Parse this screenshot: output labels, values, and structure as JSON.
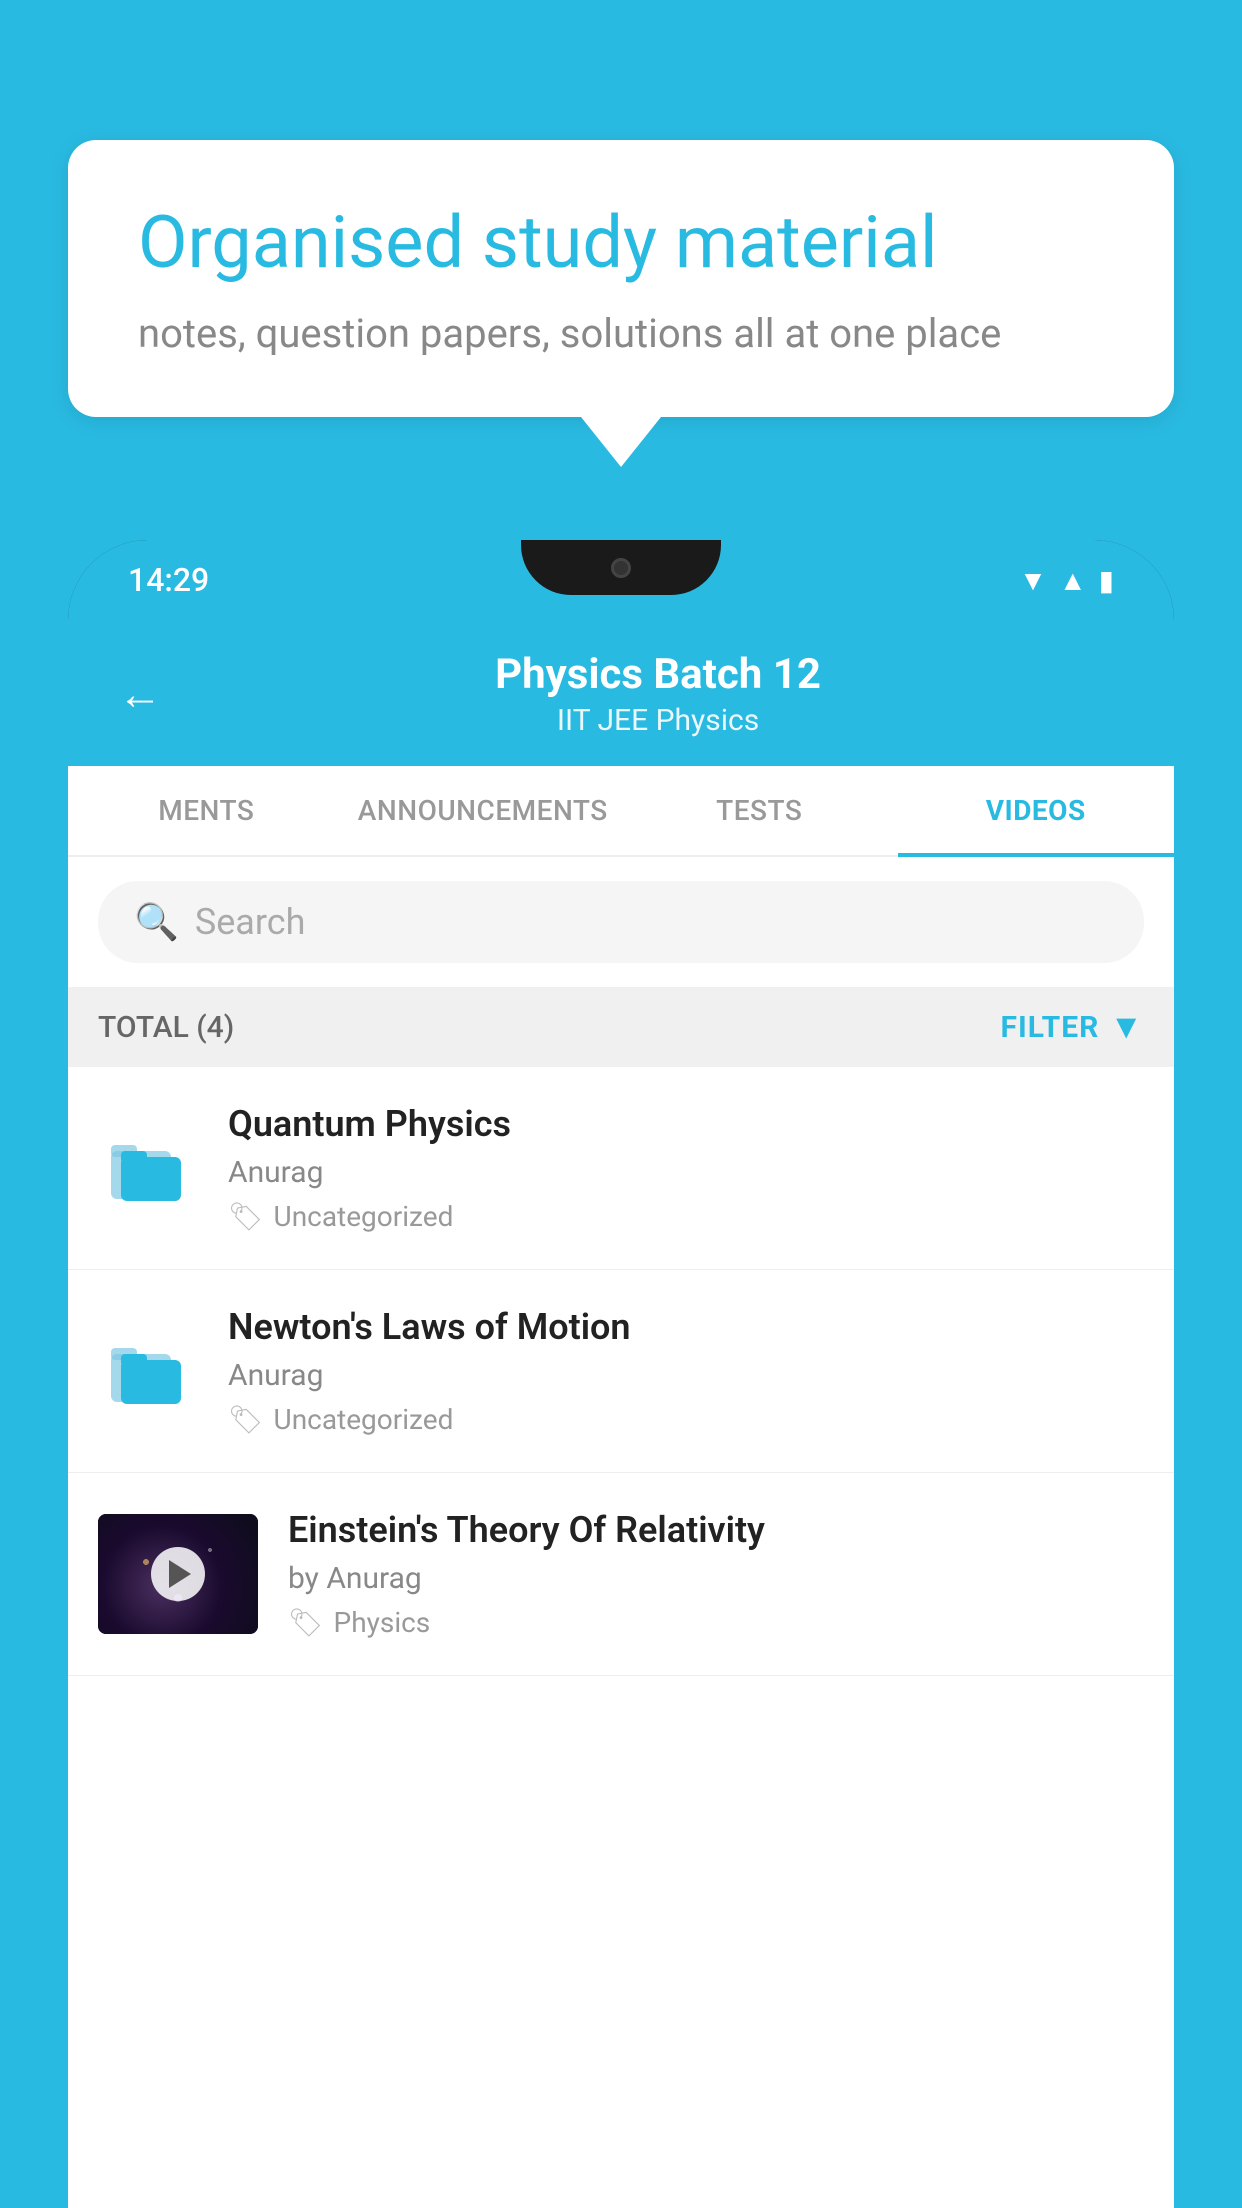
{
  "background": {
    "color": "#29BAE2"
  },
  "speech_bubble": {
    "title": "Organised study material",
    "subtitle": "notes, question papers, solutions all at one place"
  },
  "phone": {
    "status_bar": {
      "time": "14:29"
    },
    "header": {
      "back_label": "←",
      "title": "Physics Batch 12",
      "subtitle_part1": "IIT JEE",
      "subtitle_separator": "   ",
      "subtitle_part2": "Physics"
    },
    "tabs": [
      {
        "label": "MENTS",
        "active": false
      },
      {
        "label": "ANNOUNCEMENTS",
        "active": false
      },
      {
        "label": "TESTS",
        "active": false
      },
      {
        "label": "VIDEOS",
        "active": true
      }
    ],
    "search": {
      "placeholder": "Search"
    },
    "filter_row": {
      "total_label": "TOTAL (4)",
      "filter_label": "FILTER"
    },
    "videos": [
      {
        "id": "quantum",
        "title": "Quantum Physics",
        "author": "Anurag",
        "tag": "Uncategorized",
        "has_thumbnail": false
      },
      {
        "id": "newton",
        "title": "Newton's Laws of Motion",
        "author": "Anurag",
        "tag": "Uncategorized",
        "has_thumbnail": false
      },
      {
        "id": "einstein",
        "title": "Einstein's Theory Of Relativity",
        "author": "by Anurag",
        "tag": "Physics",
        "has_thumbnail": true
      }
    ]
  }
}
